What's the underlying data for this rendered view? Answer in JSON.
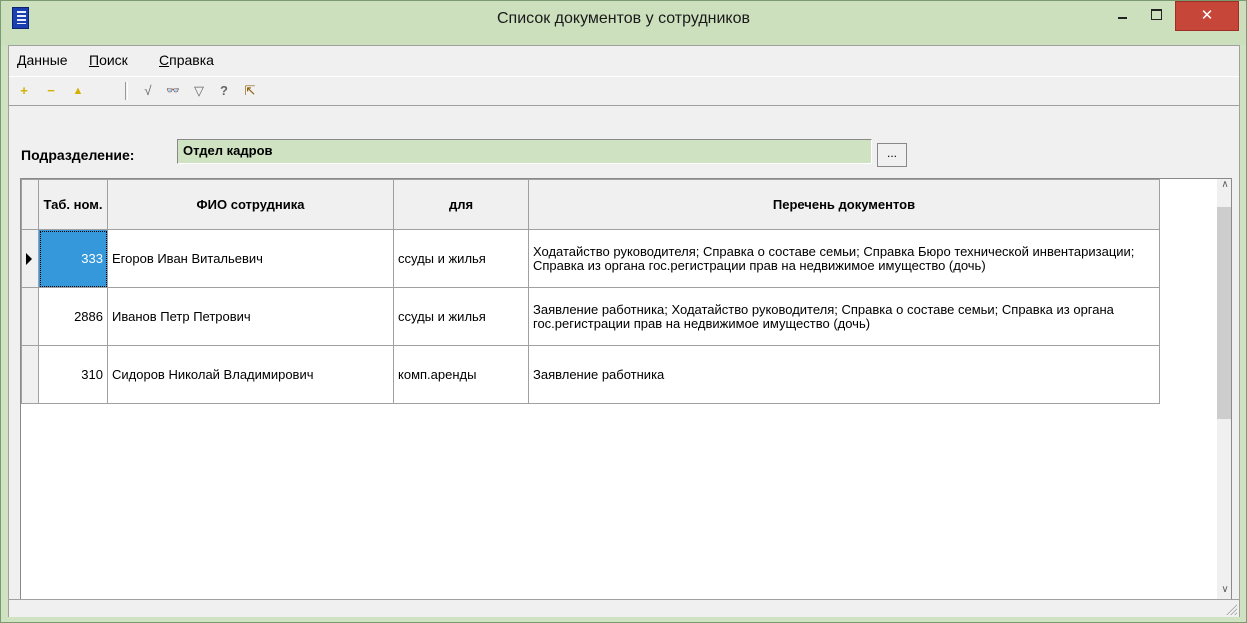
{
  "window": {
    "title": "Список документов у сотрудников"
  },
  "menu": [
    "Данные",
    "Поиск",
    "Справка"
  ],
  "menu_underline": [
    "Д",
    "П",
    "С"
  ],
  "toolbar": {
    "add_icon": "+",
    "remove_icon": "−",
    "edit_icon": "▲",
    "check_icon": "√",
    "find_icon": "👓",
    "filter_icon": "▽",
    "help_icon": "?",
    "exit_icon": "⇱"
  },
  "filter": {
    "label": "Подразделение:",
    "value": "Отдел кадров",
    "browse_label": "..."
  },
  "table": {
    "headers": [
      "Таб. ном.",
      "ФИО сотрудника",
      "для",
      "Перечень документов"
    ],
    "rows": [
      {
        "num": "333",
        "name": "Егоров Иван Витальевич",
        "for": "ссуды и жилья",
        "docs": "Ходатайство руководителя; Справка о составе семьи; Справка Бюро технической инвентаризации; Справка из органа гос.регистрации прав на недвижимое имущество (дочь)"
      },
      {
        "num": "2886",
        "name": "Иванов Петр Петрович",
        "for": "ссуды и жилья",
        "docs": "Заявление работника; Ходатайство руководителя; Справка о составе семьи; Справка из органа гос.регистрации прав на недвижимое имущество (дочь)"
      },
      {
        "num": "310",
        "name": "Сидоров Николай Владимирович",
        "for": "комп.аренды",
        "docs": "Заявление работника"
      }
    ]
  },
  "colors": {
    "frame": "#cfe3c2",
    "selected_cell": "#3498db",
    "close_button": "#c7463a"
  }
}
